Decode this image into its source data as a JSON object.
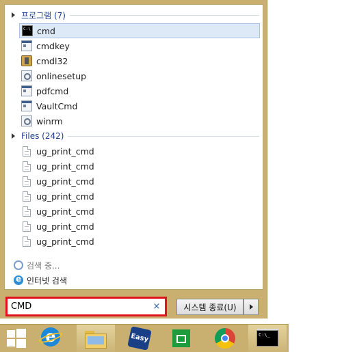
{
  "start_menu": {
    "groups": [
      {
        "header": "프로그램 (7)",
        "items": [
          {
            "label": "cmd",
            "icon": "cmd-icon",
            "selected": true
          },
          {
            "label": "cmdkey",
            "icon": "exe-icon"
          },
          {
            "label": "cmdl32",
            "icon": "tool-icon"
          },
          {
            "label": "onlinesetup",
            "icon": "gear-icon"
          },
          {
            "label": "pdfcmd",
            "icon": "exe-icon"
          },
          {
            "label": "VaultCmd",
            "icon": "exe-icon"
          },
          {
            "label": "winrm",
            "icon": "gear-icon"
          }
        ]
      },
      {
        "header": "Files (242)",
        "items": [
          {
            "label": "ug_print_cmd",
            "icon": "file-icon"
          },
          {
            "label": "ug_print_cmd",
            "icon": "file-icon"
          },
          {
            "label": "ug_print_cmd",
            "icon": "file-icon"
          },
          {
            "label": "ug_print_cmd",
            "icon": "file-icon"
          },
          {
            "label": "ug_print_cmd",
            "icon": "file-icon"
          },
          {
            "label": "ug_print_cmd",
            "icon": "file-icon"
          },
          {
            "label": "ug_print_cmd",
            "icon": "file-icon"
          }
        ]
      }
    ],
    "searching_label": "검색 중...",
    "internet_search_label": "인터넷 검색",
    "search": {
      "value": "CMD",
      "clear_glyph": "×"
    },
    "shutdown_label": "시스템 종료(U)"
  },
  "taskbar": {
    "items": [
      "windows-start-icon",
      "internet-explorer-icon",
      "file-explorer-icon",
      "easy-app-icon",
      "windows-store-icon",
      "chrome-icon",
      "command-prompt-icon"
    ],
    "easy_label": "Easy"
  },
  "colors": {
    "frame": "#c9b070",
    "highlight": "#dde9f6",
    "search_border": "#e0121e",
    "group_header": "#1a3c8c"
  }
}
